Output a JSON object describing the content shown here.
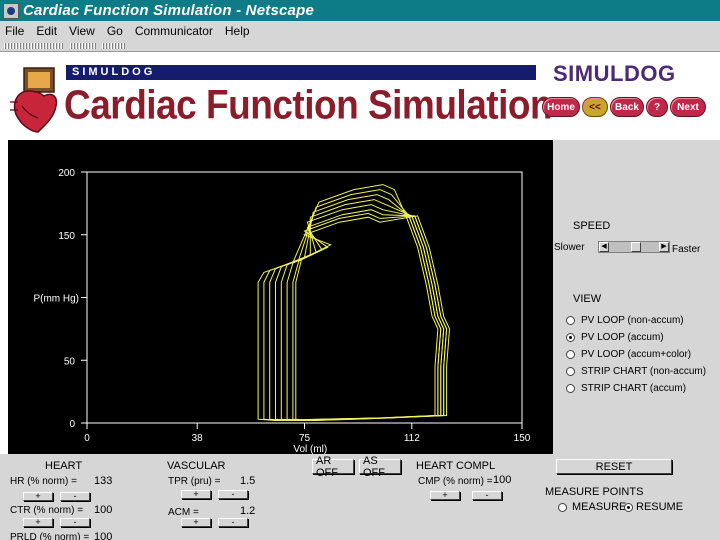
{
  "window": {
    "title": "Cardiac Function Simulation - Netscape"
  },
  "menu": {
    "items": [
      "File",
      "Edit",
      "View",
      "Go",
      "Communicator",
      "Help"
    ]
  },
  "header": {
    "brand_strip": "SIMULDOG",
    "main_title": "Cardiac Function Simulation",
    "brand_logo": "SIMULDOG"
  },
  "nav": {
    "home": "Home",
    "prev": "<<",
    "back": "Back",
    "help": "?",
    "next": "Next"
  },
  "colors": {
    "title_bar": "#0e7c86",
    "banner_title": "#8b1c2a",
    "plot_background": "#000000",
    "loop_trace": "#f2f25a",
    "panel": "#d6d6d6"
  },
  "plot": {
    "ylabel": "P(mm Hg)",
    "xlabel": "Vol (ml)",
    "yticks": [
      "200",
      "150",
      "50",
      "0"
    ],
    "xticks": [
      "0",
      "38",
      "75",
      "112",
      "150"
    ],
    "ylim": [
      0,
      200
    ],
    "xlim": [
      0,
      150
    ]
  },
  "chart_data": {
    "type": "line",
    "xlabel": "Vol (ml)",
    "ylabel": "P(mm Hg)",
    "xlim": [
      0,
      150
    ],
    "ylim": [
      0,
      200
    ],
    "note_loops": "pressure-volume loops, accumulated",
    "loops": [
      {
        "ped": 60,
        "esv": 59,
        "edv": 120,
        "peak": 190,
        "peak_v": 102
      },
      {
        "ped": 60,
        "esv": 61,
        "edv": 121,
        "peak": 186,
        "peak_v": 101
      },
      {
        "ped": 60,
        "esv": 63,
        "edv": 121,
        "peak": 182,
        "peak_v": 100
      },
      {
        "ped": 60,
        "esv": 65,
        "edv": 122,
        "peak": 178,
        "peak_v": 99
      },
      {
        "ped": 60,
        "esv": 67,
        "edv": 122,
        "peak": 174,
        "peak_v": 98
      },
      {
        "ped": 60,
        "esv": 69,
        "edv": 123,
        "peak": 170,
        "peak_v": 98
      },
      {
        "ped": 60,
        "esv": 71,
        "edv": 123,
        "peak": 167,
        "peak_v": 97
      },
      {
        "ped": 60,
        "esv": 72,
        "edv": 124,
        "peak": 164,
        "peak_v": 97
      }
    ]
  },
  "speed": {
    "title": "SPEED",
    "slower": "Slower",
    "faster": "Faster",
    "position": 0.55
  },
  "view": {
    "title": "VIEW",
    "options": [
      {
        "label": "PV LOOP (non-accum)",
        "checked": false
      },
      {
        "label": "PV LOOP (accum)",
        "checked": true
      },
      {
        "label": "PV LOOP (accum+color)",
        "checked": false
      },
      {
        "label": "STRIP CHART (non-accum)",
        "checked": false
      },
      {
        "label": "STRIP CHART (accum)",
        "checked": false
      }
    ]
  },
  "heart": {
    "title": "HEART",
    "hr_label": "HR (% norm) =",
    "hr_value": "133",
    "ctr_label": "CTR (% norm) =",
    "ctr_value": "100",
    "prld_label": "PRLD (% norm) =",
    "prld_value": "100",
    "plus": "+",
    "minus": "-"
  },
  "vascular": {
    "title": "VASCULAR",
    "tpr_label": "TPR (pru) =",
    "tpr_value": "1.5",
    "acm_label": "ACM =",
    "acm_value": "1.2"
  },
  "toggles": {
    "ar_off": "AR OFF",
    "as_off": "AS OFF"
  },
  "heart_compl": {
    "title": "HEART COMPL",
    "cmp_label": "CMP (% norm) =",
    "cmp_value": "100"
  },
  "reset": {
    "label": "RESET"
  },
  "measure": {
    "title": "MEASURE POINTS",
    "measure": "MEASURE",
    "resume": "RESUME",
    "selected": "RESUME"
  }
}
